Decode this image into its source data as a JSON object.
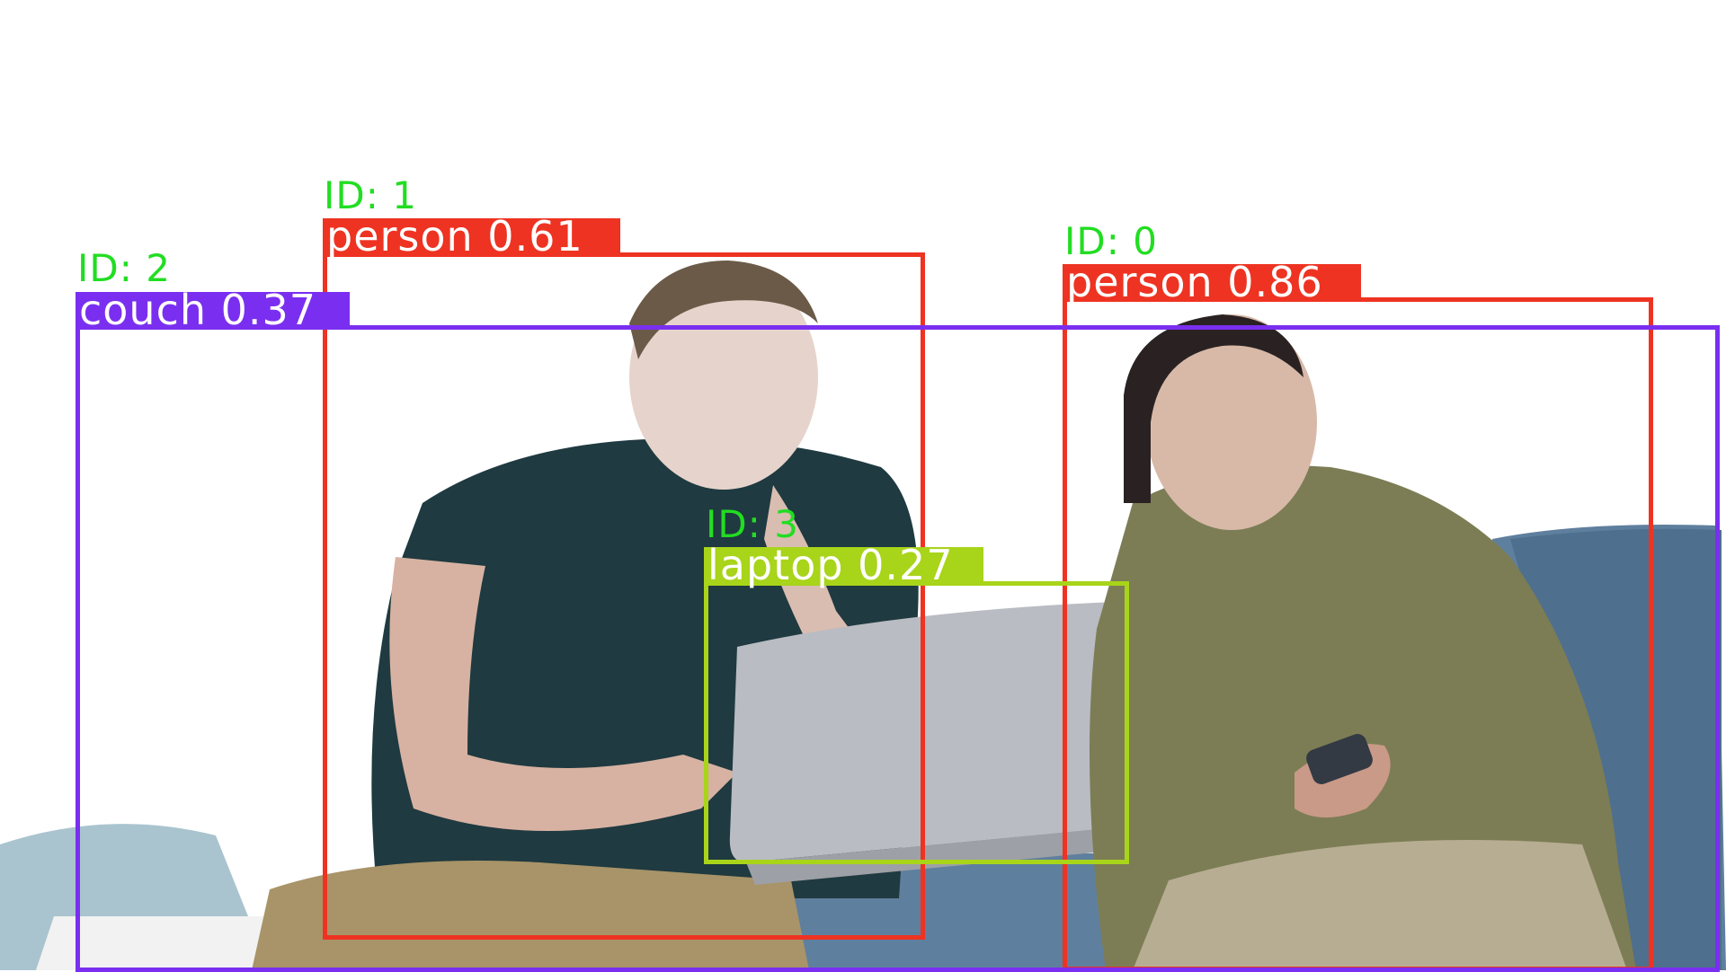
{
  "image": {
    "description_icon": "camera-photo-icon"
  },
  "colors": {
    "person": "#ee3322",
    "couch": "#7a2ff0",
    "laptop": "#a8d41a",
    "track_id": "#22dd22"
  },
  "detections": [
    {
      "id_label": "ID: 1",
      "label": "person 0.61",
      "class": "person"
    },
    {
      "id_label": "ID: 0",
      "label": "person 0.86",
      "class": "person"
    },
    {
      "id_label": "ID: 2",
      "label": "couch 0.37",
      "class": "couch"
    },
    {
      "id_label": "ID: 3",
      "label": "laptop 0.27",
      "class": "laptop"
    }
  ]
}
